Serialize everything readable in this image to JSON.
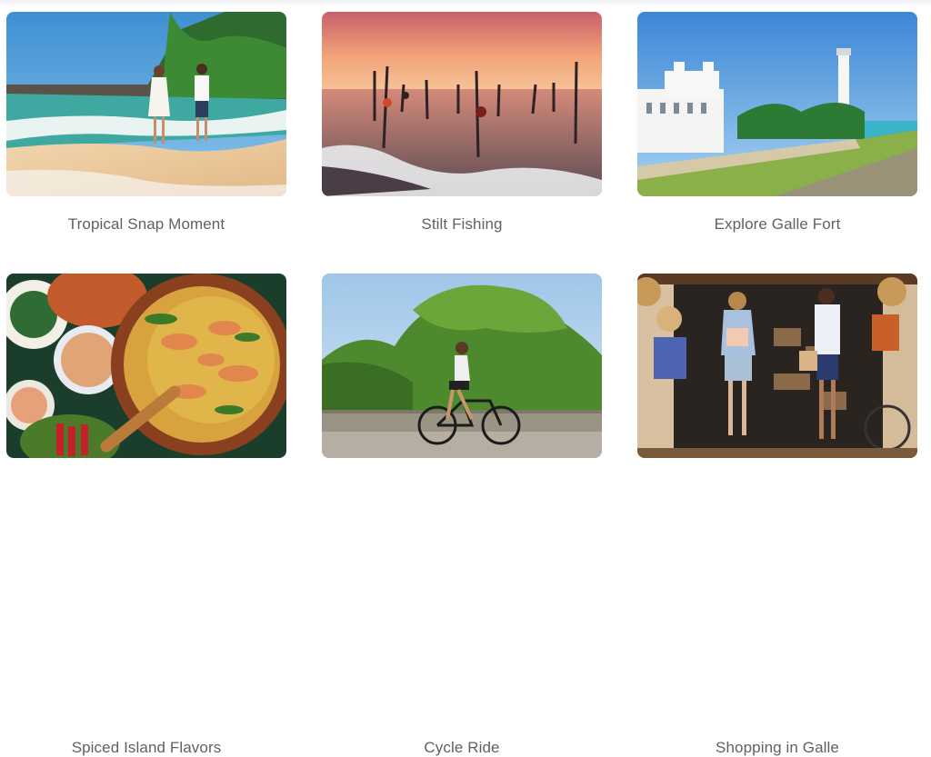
{
  "cards": [
    {
      "title": "Tropical Snap Moment",
      "image": "couple-beach-photo"
    },
    {
      "title": "Stilt Fishing",
      "image": "stilt-fishermen-photo"
    },
    {
      "title": "Explore Galle Fort",
      "image": "galle-fort-photo"
    },
    {
      "title": "Spiced Island Flavors",
      "image": "seafood-curry-photo"
    },
    {
      "title": "Cycle Ride",
      "image": "cyclist-photo"
    },
    {
      "title": "Shopping in Galle",
      "image": "shopping-galle-photo"
    }
  ],
  "colors": {
    "caption": "#5f6166",
    "background": "#ffffff"
  }
}
